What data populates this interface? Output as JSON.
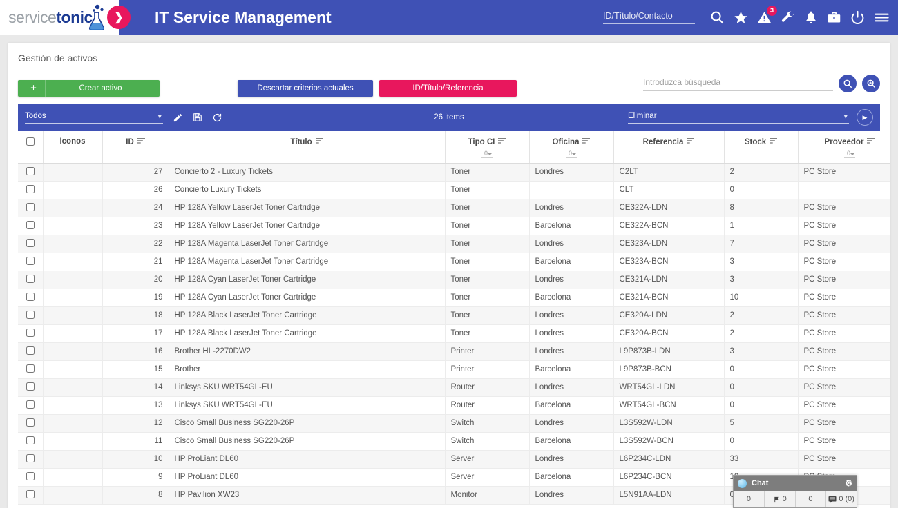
{
  "header": {
    "logo_service": "service",
    "logo_tonic": "tonic",
    "arrow_glyph": "❯",
    "app_title": "IT Service Management",
    "quick_search_label": "ID/Título/Contacto",
    "alert_badge": "3",
    "icons": [
      {
        "name": "search-icon"
      },
      {
        "name": "star-icon"
      },
      {
        "name": "warning-icon"
      },
      {
        "name": "wrench-icon"
      },
      {
        "name": "bell-icon"
      },
      {
        "name": "briefcase-icon"
      },
      {
        "name": "power-icon"
      },
      {
        "name": "hamburger-menu-icon"
      }
    ],
    "brand_blue": "#3f51b5",
    "brand_pink": "#e8175d"
  },
  "page": {
    "title": "Gestión de activos"
  },
  "toolbar": {
    "create_plus": "+",
    "create_label": "Crear activo",
    "discard_label": "Descartar criterios actuales",
    "idref_label": "ID/Título/Referencia",
    "search_placeholder": "Introduzca búsqueda",
    "search_value": "",
    "search_icon": "search-icon",
    "advanced_search_icon": "search-plus-icon",
    "green": "#4caf50",
    "blue": "#3f51b5",
    "pink": "#e8175d"
  },
  "grid_toolbar": {
    "view_select": "Todos",
    "edit_icon": "pencil-icon",
    "save_icon": "floppy-disk-icon",
    "refresh_icon": "refresh-icon",
    "items_count": "26 items",
    "action_select": "Eliminar",
    "run_icon": "play-icon"
  },
  "table": {
    "columns": [
      {
        "key": "check",
        "label": "",
        "sortable": false,
        "filter": "none"
      },
      {
        "key": "icons",
        "label": "Iconos",
        "sortable": false,
        "filter": "none"
      },
      {
        "key": "id",
        "label": "ID",
        "sortable": true,
        "filter": "text"
      },
      {
        "key": "titulo",
        "label": "Título",
        "sortable": true,
        "filter": "text"
      },
      {
        "key": "tipo",
        "label": "Tipo CI",
        "sortable": true,
        "filter": "select",
        "filter_value": "0"
      },
      {
        "key": "oficina",
        "label": "Oficina",
        "sortable": true,
        "filter": "select",
        "filter_value": "0"
      },
      {
        "key": "ref",
        "label": "Referencia",
        "sortable": true,
        "filter": "text"
      },
      {
        "key": "stock",
        "label": "Stock",
        "sortable": true,
        "filter": "none"
      },
      {
        "key": "prov",
        "label": "Proveedor",
        "sortable": true,
        "filter": "select",
        "filter_value": "0"
      }
    ],
    "rows": [
      {
        "id": "27",
        "titulo": "Concierto 2 - Luxury Tickets",
        "tipo": "Toner",
        "oficina": "Londres",
        "ref": "C2LT",
        "stock": "2",
        "prov": "PC Store"
      },
      {
        "id": "26",
        "titulo": "Concierto Luxury Tickets",
        "tipo": "Toner",
        "oficina": "",
        "ref": "CLT",
        "stock": "0",
        "prov": ""
      },
      {
        "id": "24",
        "titulo": "HP 128A Yellow LaserJet Toner Cartridge",
        "tipo": "Toner",
        "oficina": "Londres",
        "ref": "CE322A-LDN",
        "stock": "8",
        "prov": "PC Store"
      },
      {
        "id": "23",
        "titulo": "HP 128A Yellow LaserJet Toner Cartridge",
        "tipo": "Toner",
        "oficina": "Barcelona",
        "ref": "CE322A-BCN",
        "stock": "1",
        "prov": "PC Store"
      },
      {
        "id": "22",
        "titulo": "HP 128A Magenta LaserJet Toner Cartridge",
        "tipo": "Toner",
        "oficina": "Londres",
        "ref": "CE323A-LDN",
        "stock": "7",
        "prov": "PC Store"
      },
      {
        "id": "21",
        "titulo": "HP 128A Magenta LaserJet Toner Cartridge",
        "tipo": "Toner",
        "oficina": "Barcelona",
        "ref": "CE323A-BCN",
        "stock": "3",
        "prov": "PC Store"
      },
      {
        "id": "20",
        "titulo": "HP 128A Cyan LaserJet Toner Cartridge",
        "tipo": "Toner",
        "oficina": "Londres",
        "ref": "CE321A-LDN",
        "stock": "3",
        "prov": "PC Store"
      },
      {
        "id": "19",
        "titulo": "HP 128A Cyan LaserJet Toner Cartridge",
        "tipo": "Toner",
        "oficina": "Barcelona",
        "ref": "CE321A-BCN",
        "stock": "10",
        "prov": "PC Store"
      },
      {
        "id": "18",
        "titulo": "HP 128A Black LaserJet Toner Cartridge",
        "tipo": "Toner",
        "oficina": "Londres",
        "ref": "CE320A-LDN",
        "stock": "2",
        "prov": "PC Store"
      },
      {
        "id": "17",
        "titulo": "HP 128A Black LaserJet Toner Cartridge",
        "tipo": "Toner",
        "oficina": "Londres",
        "ref": "CE320A-BCN",
        "stock": "2",
        "prov": "PC Store"
      },
      {
        "id": "16",
        "titulo": "Brother HL-2270DW2",
        "tipo": "Printer",
        "oficina": "Londres",
        "ref": "L9P873B-LDN",
        "stock": "3",
        "prov": "PC Store"
      },
      {
        "id": "15",
        "titulo": "Brother",
        "tipo": "Printer",
        "oficina": "Barcelona",
        "ref": "L9P873B-BCN",
        "stock": "0",
        "prov": "PC Store"
      },
      {
        "id": "14",
        "titulo": "Linksys SKU WRT54GL-EU",
        "tipo": "Router",
        "oficina": "Londres",
        "ref": "WRT54GL-LDN",
        "stock": "0",
        "prov": "PC Store"
      },
      {
        "id": "13",
        "titulo": "Linksys SKU WRT54GL-EU",
        "tipo": "Router",
        "oficina": "Barcelona",
        "ref": "WRT54GL-BCN",
        "stock": "0",
        "prov": "PC Store"
      },
      {
        "id": "12",
        "titulo": "Cisco Small Business SG220-26P",
        "tipo": "Switch",
        "oficina": "Londres",
        "ref": "L3S592W-LDN",
        "stock": "5",
        "prov": "PC Store"
      },
      {
        "id": "11",
        "titulo": "Cisco Small Business SG220-26P",
        "tipo": "Switch",
        "oficina": "Barcelona",
        "ref": "L3S592W-BCN",
        "stock": "0",
        "prov": "PC Store"
      },
      {
        "id": "10",
        "titulo": "HP ProLiant DL60",
        "tipo": "Server",
        "oficina": "Londres",
        "ref": "L6P234C-LDN",
        "stock": "33",
        "prov": "PC Store"
      },
      {
        "id": "9",
        "titulo": "HP ProLiant DL60",
        "tipo": "Server",
        "oficina": "Barcelona",
        "ref": "L6P234C-BCN",
        "stock": "10",
        "prov": "PC Store"
      },
      {
        "id": "8",
        "titulo": "HP Pavilion XW23",
        "tipo": "Monitor",
        "oficina": "Londres",
        "ref": "L5N91AA-LDN",
        "stock": "0",
        "prov": ""
      }
    ]
  },
  "chat": {
    "title": "Chat",
    "gear_icon": "gear-icon",
    "count_1": "0",
    "count_flag": "0",
    "count_2": "0",
    "count_msg": "0 (0)"
  }
}
